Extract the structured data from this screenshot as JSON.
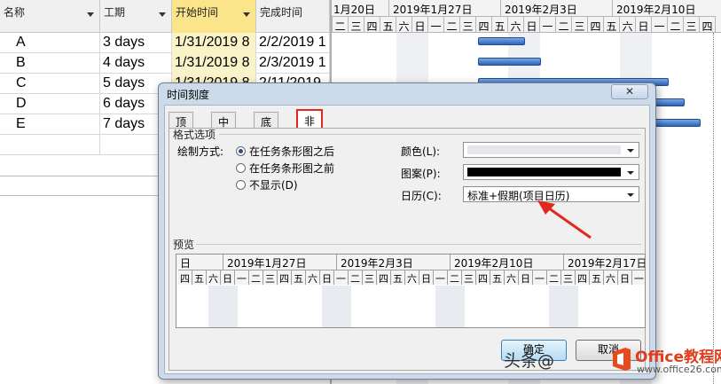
{
  "table": {
    "columns": [
      {
        "label": "名称",
        "width": 113,
        "selected": false
      },
      {
        "label": "工期",
        "width": 81,
        "selected": false
      },
      {
        "label": "开始时间",
        "width": 95,
        "selected": true
      },
      {
        "label": "完成时间",
        "width": 83,
        "selected": false
      }
    ],
    "rows": [
      {
        "name": "A",
        "duration": "3 days",
        "start": "1/31/2019 8",
        "finish": "2/2/2019 1"
      },
      {
        "name": "B",
        "duration": "4 days",
        "start": "1/31/2019 8",
        "finish": "2/3/2019 1"
      },
      {
        "name": "C",
        "duration": "5 days",
        "start": "1/31/2019 8",
        "finish": "2/11/2019"
      },
      {
        "name": "D",
        "duration": "6 days",
        "start": "",
        "finish": ""
      },
      {
        "name": "E",
        "duration": "7 days",
        "start": "",
        "finish": ""
      }
    ]
  },
  "gantt": {
    "weeks": [
      "1月20日",
      "2019年1月27日",
      "2019年2月3日",
      "2019年2月10日"
    ],
    "days": [
      "一",
      "二",
      "三",
      "四",
      "五",
      "六",
      "日",
      "一",
      "二",
      "三",
      "四",
      "五",
      "六",
      "日",
      "一",
      "二",
      "三",
      "四",
      "五",
      "六",
      "日",
      "一",
      "二",
      "三",
      "四"
    ],
    "bar_color": "#3a6fc4"
  },
  "dialog": {
    "title": "时间刻度",
    "close_label": "✕",
    "tabs": [
      {
        "label": "顶层",
        "active": false
      },
      {
        "label": "中层",
        "active": false
      },
      {
        "label": "底层",
        "active": false
      },
      {
        "label": "非工作时间",
        "active": true
      }
    ],
    "format_section": "格式选项",
    "draw_label": "绘制方式:",
    "draw_options": [
      {
        "label": "在任务条形图之后",
        "checked": true
      },
      {
        "label": "在任务条形图之前",
        "checked": false
      },
      {
        "label": "不显示(D)",
        "checked": false
      }
    ],
    "color_label": "颜色(L):",
    "color_value": "#e6e6ea",
    "pattern_label": "图案(P):",
    "pattern_value": "#000000",
    "calendar_label": "日历(C):",
    "calendar_value": "标准+假期(项目日历)",
    "preview_section": "预览",
    "preview_weeks": [
      "日",
      "2019年1月27日",
      "2019年2月3日",
      "2019年2月10日",
      "2019年2月17日"
    ],
    "preview_days": [
      "四",
      "五",
      "六",
      "日",
      "一",
      "二",
      "三",
      "四",
      "五",
      "六",
      "日",
      "一",
      "二",
      "三",
      "四",
      "五",
      "六",
      "日",
      "一",
      "二",
      "三",
      "四",
      "五",
      "六",
      "日",
      "一",
      "二",
      "三",
      "四",
      "五",
      "六",
      "日",
      "一",
      "二",
      "三",
      "四",
      "五"
    ],
    "ok_label": "确定",
    "cancel_label": "取消",
    "accent_color": "#e0281e"
  },
  "watermark": {
    "text": "头条@",
    "logo_title": "Office教程网",
    "logo_sub": "www.office26.com"
  }
}
